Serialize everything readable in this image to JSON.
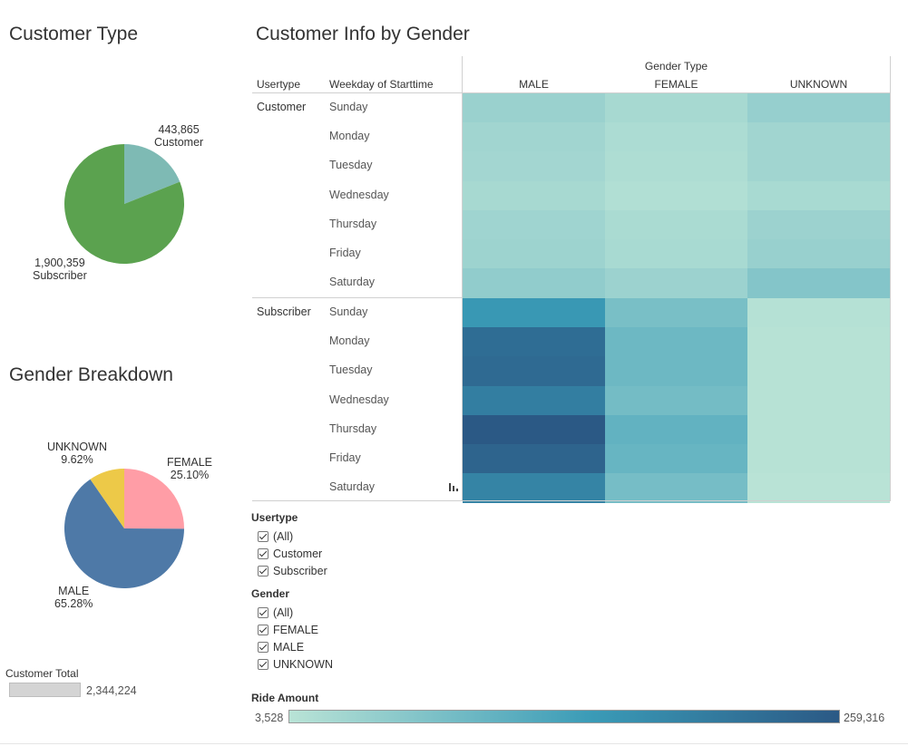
{
  "titles": {
    "customer_type": "Customer Type",
    "gender_breakdown": "Gender Breakdown",
    "heatmap": "Customer Info by Gender"
  },
  "customer_type_pie": {
    "customer_value": "443,865",
    "customer_label": "Customer",
    "subscriber_value": "1,900,359",
    "subscriber_label": "Subscriber"
  },
  "gender_pie": {
    "unknown_label": "UNKNOWN",
    "unknown_pct": "9.62%",
    "female_label": "FEMALE",
    "female_pct": "25.10%",
    "male_label": "MALE",
    "male_pct": "65.28%"
  },
  "customer_total": {
    "label": "Customer Total",
    "value": "2,344,224"
  },
  "heatmap_headers": {
    "usertype": "Usertype",
    "weekday": "Weekday of Starttime",
    "gender_type": "Gender Type"
  },
  "filters": {
    "usertype": {
      "title": "Usertype",
      "items": [
        "(All)",
        "Customer",
        "Subscriber"
      ]
    },
    "gender": {
      "title": "Gender",
      "items": [
        "(All)",
        "FEMALE",
        "MALE",
        "UNKNOWN"
      ]
    }
  },
  "ride_legend": {
    "title": "Ride Amount",
    "min_label": "3,528",
    "max_label": "259,316",
    "color_low": "#b9e3d6",
    "color_high": "#2b5985"
  },
  "colors": {
    "customer_slice": "#7ebab4",
    "subscriber_slice": "#5ba24f",
    "female_slice": "#ff9da6",
    "male_slice": "#4e79a7",
    "unknown_slice": "#edc948"
  },
  "chart_data": [
    {
      "type": "pie",
      "title": "Customer Type",
      "categories": [
        "Customer",
        "Subscriber"
      ],
      "values": [
        443865,
        1900359
      ]
    },
    {
      "type": "pie",
      "title": "Gender Breakdown",
      "categories": [
        "FEMALE",
        "MALE",
        "UNKNOWN"
      ],
      "values": [
        25.1,
        65.28,
        9.62
      ]
    },
    {
      "type": "heatmap",
      "title": "Customer Info by Gender",
      "row_groups": [
        "Customer",
        "Subscriber"
      ],
      "rows": [
        "Sunday",
        "Monday",
        "Tuesday",
        "Wednesday",
        "Thursday",
        "Friday",
        "Saturday"
      ],
      "columns": [
        "MALE",
        "FEMALE",
        "UNKNOWN"
      ],
      "value_range": [
        3528,
        259316
      ],
      "values": {
        "Customer": [
          [
            38000,
            24000,
            42000
          ],
          [
            30000,
            18000,
            30000
          ],
          [
            28000,
            16000,
            30000
          ],
          [
            24000,
            12000,
            22000
          ],
          [
            32000,
            20000,
            36000
          ],
          [
            34000,
            22000,
            40000
          ],
          [
            48000,
            36000,
            62000
          ]
        ],
        "Subscriber": [
          [
            150000,
            74000,
            8000
          ],
          [
            225000,
            88000,
            6000
          ],
          [
            230000,
            88000,
            6000
          ],
          [
            195000,
            80000,
            6000
          ],
          [
            259316,
            100000,
            6000
          ],
          [
            240000,
            94000,
            6000
          ],
          [
            185000,
            78000,
            3528
          ]
        ]
      }
    }
  ]
}
